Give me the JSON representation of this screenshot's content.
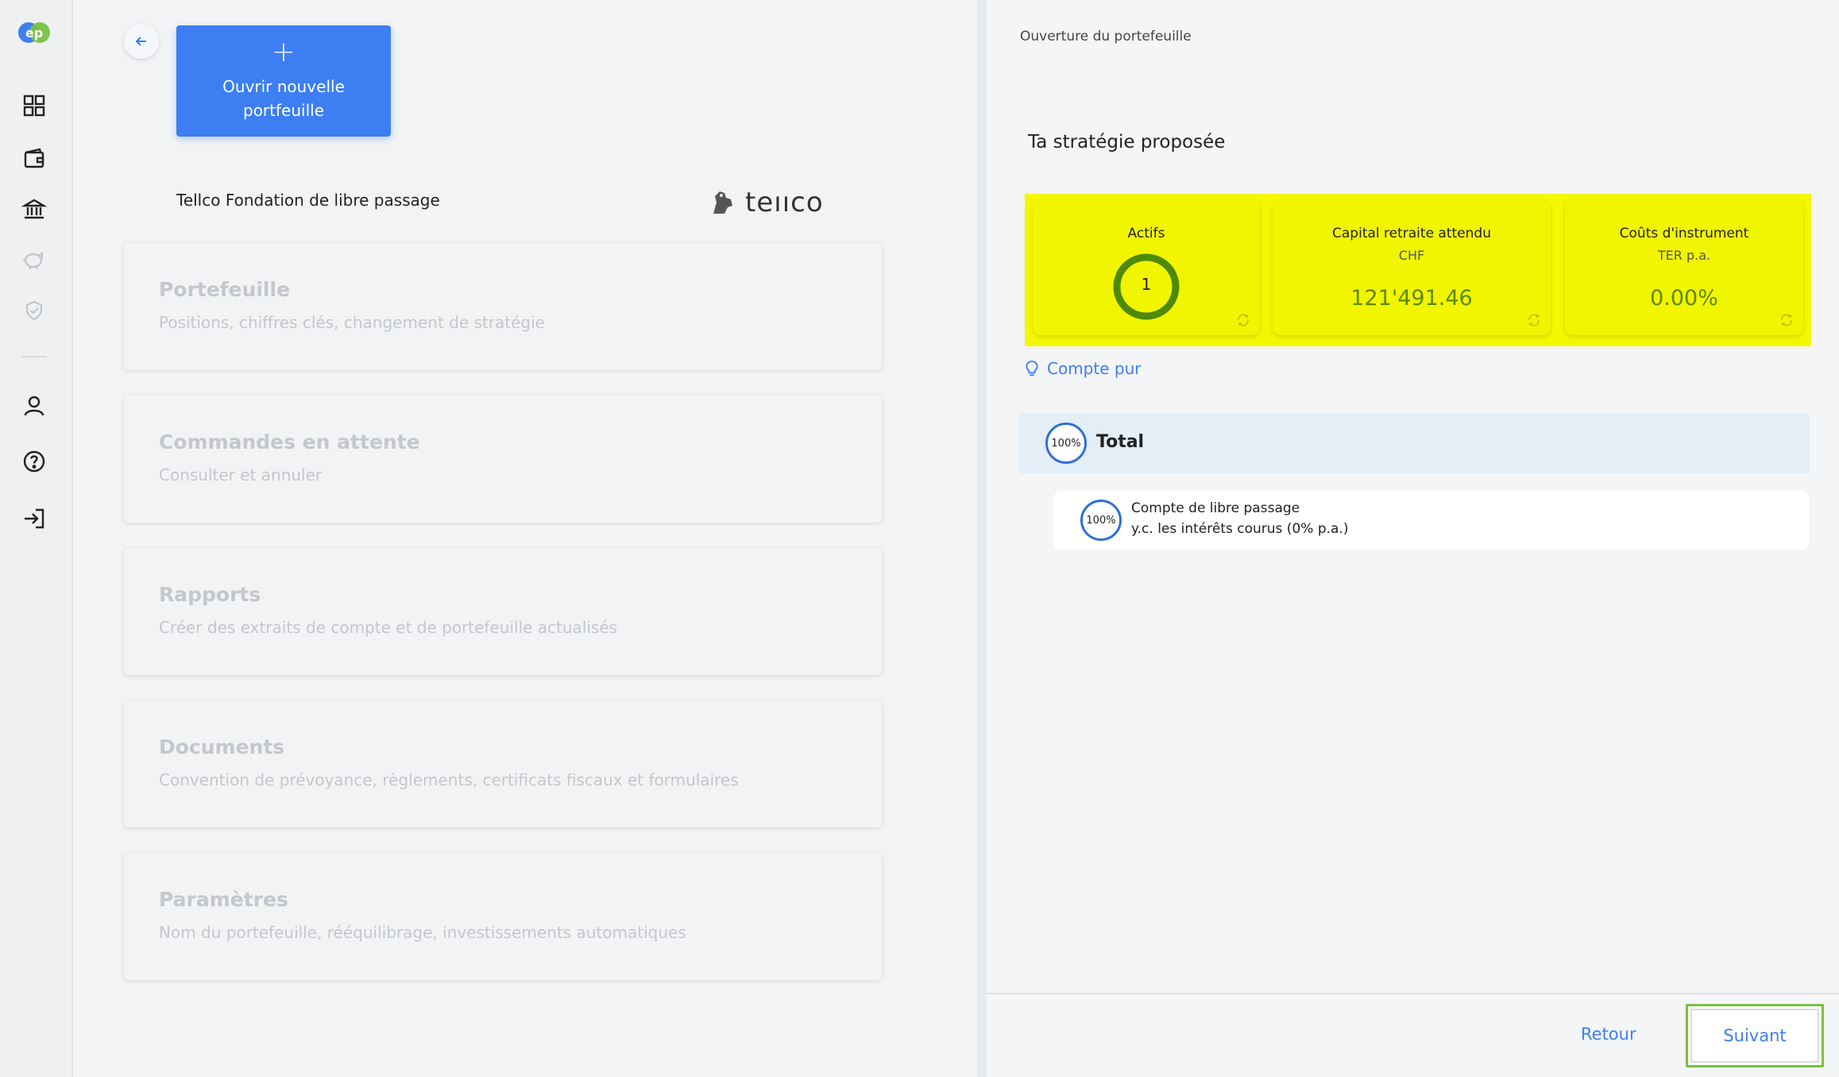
{
  "sidebar": {
    "logo_text": "ep",
    "items": [
      {
        "icon": "dashboard-grid-icon"
      },
      {
        "icon": "wallet-icon"
      },
      {
        "icon": "bank-icon"
      },
      {
        "icon": "piggy-bank-icon"
      },
      {
        "icon": "shield-icon"
      },
      {
        "icon": "user-icon"
      },
      {
        "icon": "help-icon"
      },
      {
        "icon": "logout-icon"
      }
    ]
  },
  "left": {
    "new_portfolio_label": "Ouvrir nouvelle portfeuille",
    "foundation_name": "Tellco Fondation de libre passage",
    "brand_name": "teııco",
    "cards": [
      {
        "title": "Portefeuille",
        "subtitle": "Positions, chiffres clés, changement de stratégie"
      },
      {
        "title": "Commandes en attente",
        "subtitle": "Consulter et annuler"
      },
      {
        "title": "Rapports",
        "subtitle": "Créer des extraits de compte et de portefeuille actualisés"
      },
      {
        "title": "Documents",
        "subtitle": "Convention de prévoyance, règlements, certificats fiscaux et formulaires"
      },
      {
        "title": "Paramètres",
        "subtitle": "Nom du portefeuille, rééquilibrage, investissements automatiques"
      }
    ]
  },
  "right": {
    "breadcrumb": "Ouverture du portefeuille",
    "strategy_title": "Ta stratégie proposée",
    "kpis": {
      "assets": {
        "title": "Actifs",
        "value": "1"
      },
      "capital": {
        "title": "Capital retraite attendu",
        "subtitle": "CHF",
        "value": "121'491.46"
      },
      "costs": {
        "title": "Coûts d'instrument",
        "subtitle": "TER p.a.",
        "value": "0.00%"
      }
    },
    "hint": "Compte pur",
    "total": {
      "percent": "100%",
      "label": "Total"
    },
    "items": [
      {
        "percent": "100%",
        "line1": "Compte de libre passage",
        "line2": "y.c. les intérêts courus (0% p.a.)"
      }
    ],
    "footer": {
      "back_label": "Retour",
      "next_label": "Suivant"
    }
  },
  "colors": {
    "accent": "#3d7ef2",
    "highlight": "#f5f700",
    "value_green": "#5a8a00",
    "next_border": "#7ac142"
  }
}
